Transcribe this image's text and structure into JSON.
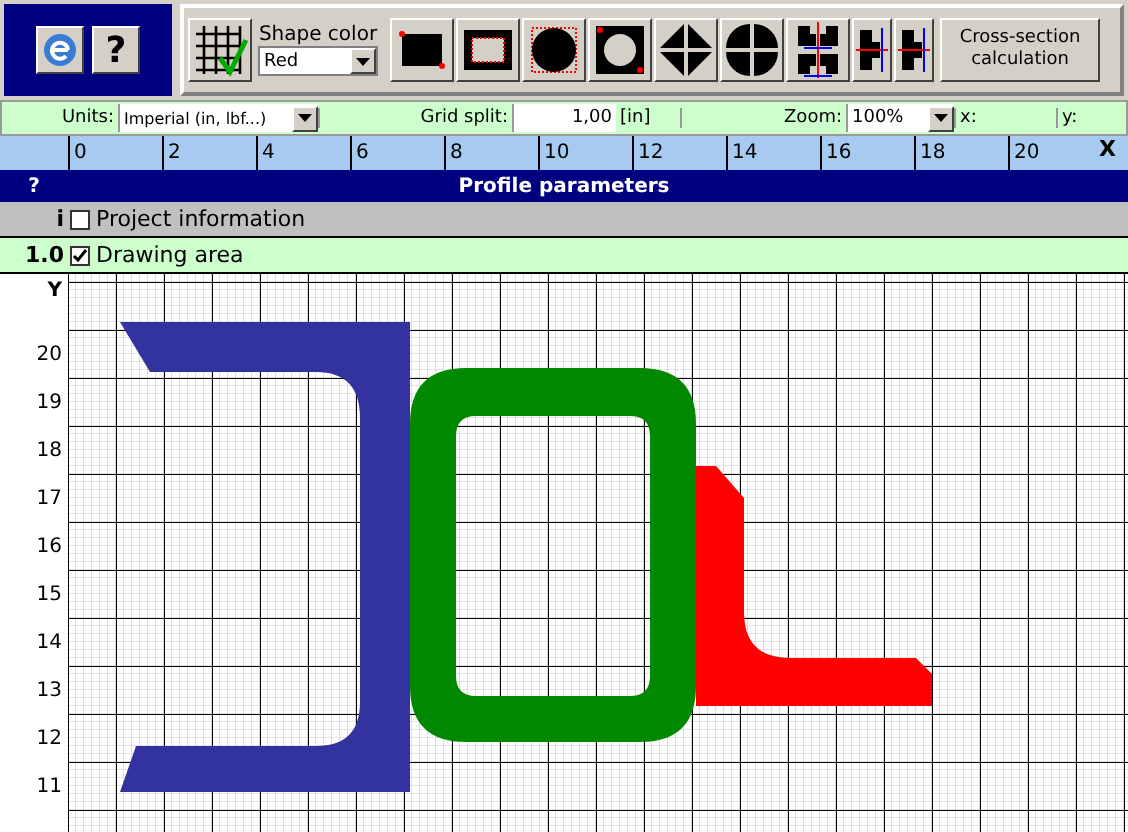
{
  "help_button": "?",
  "shape_color": {
    "label": "Shape color",
    "value": "Red"
  },
  "calc_button": "Cross-section calculation",
  "settings": {
    "units_label": "Units:",
    "units_value": "Imperial (in, lbf...)",
    "grid_label": "Grid split:",
    "grid_value": "1,00",
    "grid_unit": "[in]",
    "zoom_label": "Zoom:",
    "zoom_value": "100%",
    "x_label": "x:",
    "y_label": "y:"
  },
  "ruler": {
    "labels": [
      "0",
      "2",
      "4",
      "6",
      "8",
      "10",
      "12",
      "14",
      "16",
      "18",
      "20"
    ],
    "close": "X"
  },
  "header": {
    "help": "?",
    "title": "Profile parameters"
  },
  "sections": [
    {
      "index": "i",
      "label": "Project information",
      "checked": false,
      "kind": "info"
    },
    {
      "index": "1.0",
      "label": "Drawing area",
      "checked": true,
      "kind": "drawing"
    }
  ],
  "y_axis": {
    "title": "Y",
    "labels": [
      "20",
      "19",
      "18",
      "17",
      "16",
      "15",
      "14",
      "13",
      "12",
      "11"
    ]
  },
  "shapes": [
    {
      "kind": "channel",
      "color": "#3333a0"
    },
    {
      "kind": "tube",
      "color": "#008800"
    },
    {
      "kind": "angle",
      "color": "#ff0000"
    }
  ]
}
